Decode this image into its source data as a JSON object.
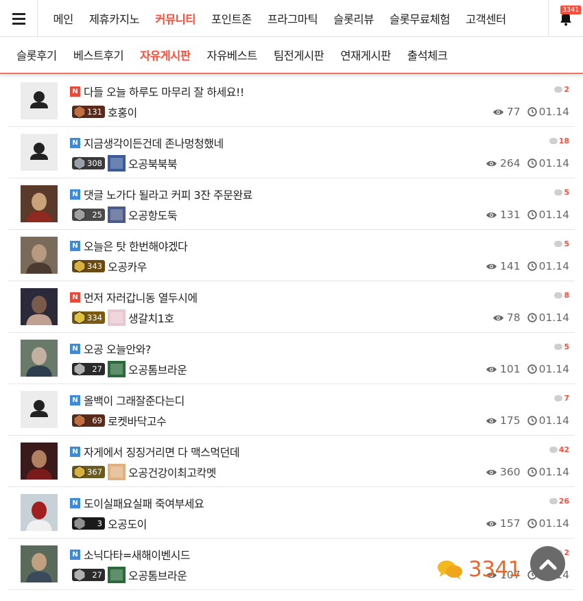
{
  "header": {
    "nav": [
      "메인",
      "제휴카지노",
      "커뮤니티",
      "포인트존",
      "프라그마틱",
      "슬롯리뷰",
      "슬롯무료체험",
      "고객센터"
    ],
    "active_index": 2,
    "notification_count": "3341"
  },
  "subnav": {
    "items": [
      "슬롯후기",
      "베스트후기",
      "자유게시판",
      "자유베스트",
      "팀전게시판",
      "연재게시판",
      "출석체크"
    ],
    "active_index": 2
  },
  "posts": [
    {
      "tag": "N",
      "tag_color": "red",
      "title": "다들 오늘 하루도 마무리 잘 하세요!!",
      "comments": "2",
      "level": "131",
      "nickname": "호홍이",
      "views": "77",
      "date": "01.14",
      "avatar": "default",
      "has_thumb": false
    },
    {
      "tag": "N",
      "tag_color": "blue",
      "title": "지금생각이든건데 존나멍청했네",
      "comments": "18",
      "level": "308",
      "nickname": "오공북북북",
      "views": "264",
      "date": "01.14",
      "avatar": "default",
      "has_thumb": true
    },
    {
      "tag": "N",
      "tag_color": "blue",
      "title": "댓글 노가다 될라고 커피 3잔 주문완료",
      "comments": "5",
      "level": "25",
      "nickname": "오공항도둑",
      "views": "131",
      "date": "01.14",
      "avatar": "photo",
      "has_thumb": true
    },
    {
      "tag": "N",
      "tag_color": "blue",
      "title": "오늘은 탓 한번해야겠다",
      "comments": "5",
      "level": "343",
      "nickname": "오공카우",
      "views": "141",
      "date": "01.14",
      "avatar": "photo",
      "has_thumb": false
    },
    {
      "tag": "N",
      "tag_color": "red",
      "title": "먼저 자러갑니동 열두시에",
      "comments": "8",
      "level": "334",
      "nickname": "생갈치1호",
      "views": "78",
      "date": "01.14",
      "avatar": "photo",
      "has_thumb": true
    },
    {
      "tag": "N",
      "tag_color": "blue",
      "title": "오공 오늘안와?",
      "comments": "5",
      "level": "27",
      "nickname": "오공톰브라운",
      "views": "101",
      "date": "01.14",
      "avatar": "photo",
      "has_thumb": true
    },
    {
      "tag": "N",
      "tag_color": "blue",
      "title": "올백이 그래잘준다는디",
      "comments": "7",
      "level": "69",
      "nickname": "로켓바닥고수",
      "views": "175",
      "date": "01.14",
      "avatar": "default",
      "has_thumb": false
    },
    {
      "tag": "N",
      "tag_color": "blue",
      "title": "자게에서 징징거리면 다 맥스먹던데",
      "comments": "42",
      "level": "367",
      "nickname": "오공건강이최고칵멧",
      "views": "360",
      "date": "01.14",
      "avatar": "photo",
      "has_thumb": true
    },
    {
      "tag": "N",
      "tag_color": "blue",
      "title": "도이실패요실패 죽여부세요",
      "comments": "26",
      "level": "3",
      "nickname": "오공도이",
      "views": "157",
      "date": "01.14",
      "avatar": "photo",
      "has_thumb": false
    },
    {
      "tag": "N",
      "tag_color": "blue",
      "title": "소닉다타=새해이벤시드",
      "comments": "2",
      "level": "27",
      "nickname": "오공톰브라운",
      "views": "107",
      "date": "01.14",
      "avatar": "photo",
      "has_thumb": true
    }
  ],
  "floating": {
    "chat_count": "3341"
  },
  "colors": {
    "accent": "#ff4d3a",
    "tag_red": "#e8493a",
    "tag_blue": "#3c8ad8",
    "float_orange": "#e8672a"
  }
}
